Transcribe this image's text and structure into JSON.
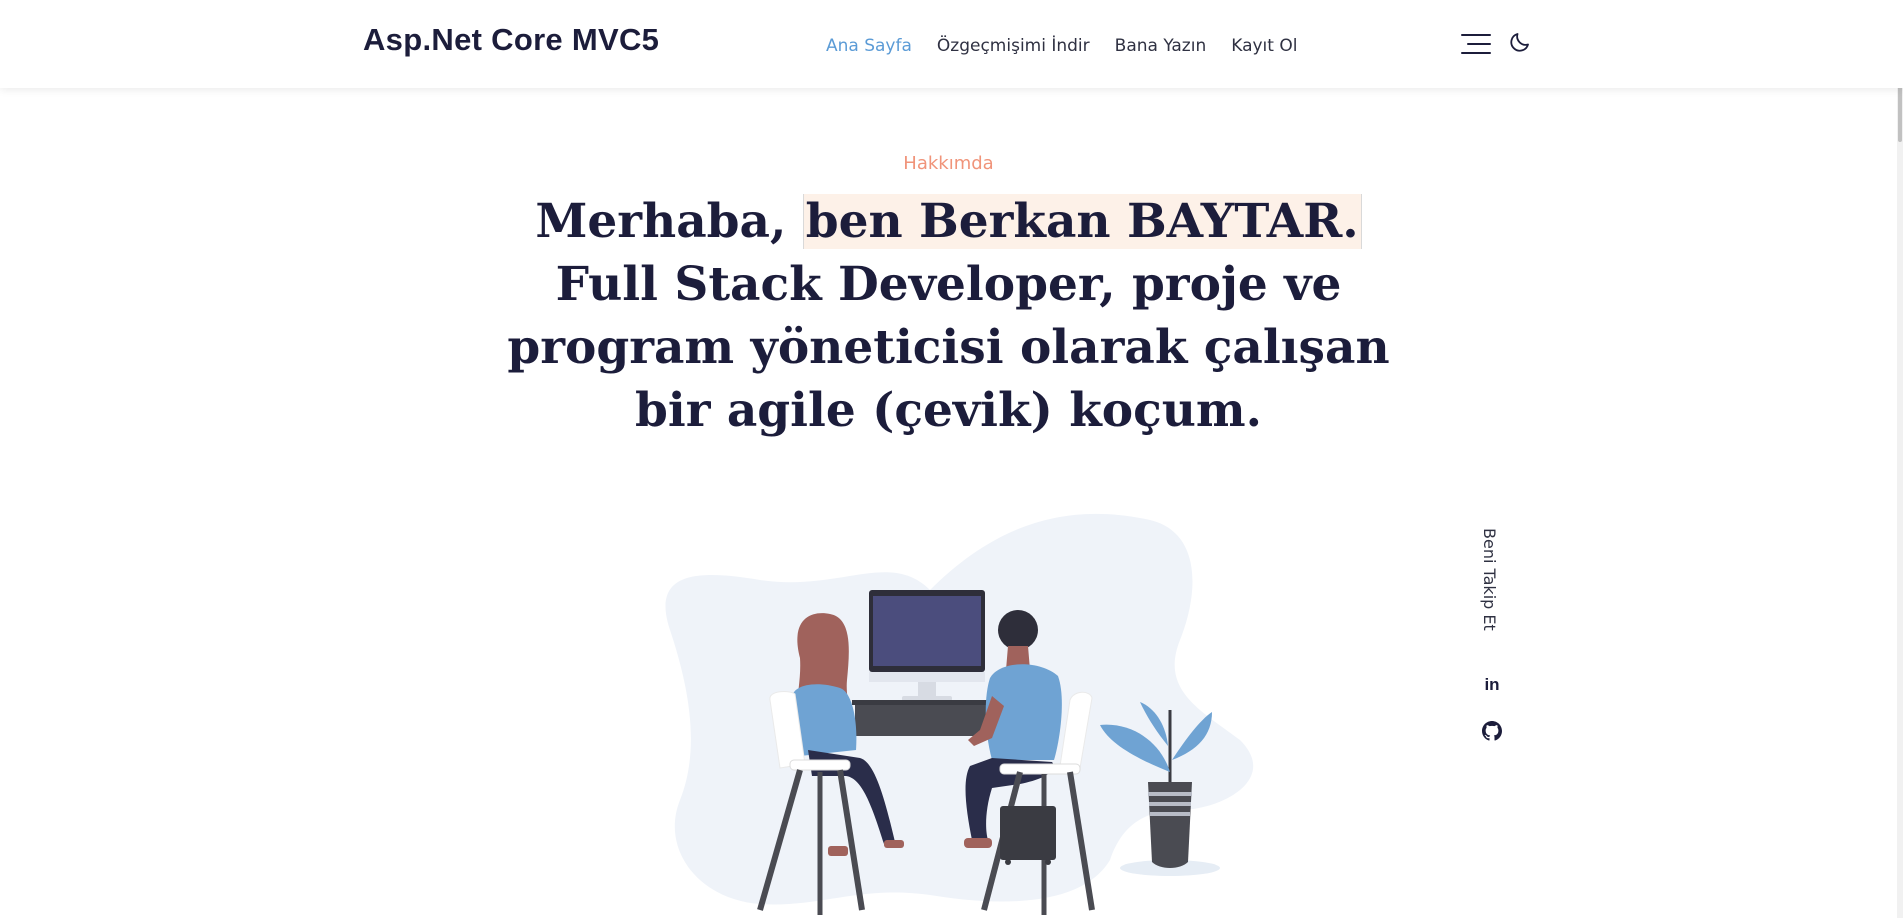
{
  "header": {
    "brand": "Asp.Net Core MVC5",
    "nav": [
      {
        "label": "Ana Sayfa",
        "active": true
      },
      {
        "label": "Özgeçmişimi İndir",
        "active": false
      },
      {
        "label": "Bana Yazın",
        "active": false
      },
      {
        "label": "Kayıt Ol",
        "active": false
      }
    ],
    "icons": [
      "menu-icon",
      "moon-icon"
    ]
  },
  "about": {
    "eyebrow": "Hakkımda",
    "headline_prefix": "Merhaba, ",
    "headline_highlight": "ben Berkan BAYTAR.",
    "headline_rest": "Full Stack Developer, proje ve program yöneticisi olarak çalışan bir agile (çevik) koçum."
  },
  "sidebar": {
    "follow_label": "Beni Takip Et",
    "socials": [
      "linkedin-icon",
      "github-icon"
    ]
  },
  "colors": {
    "accent_blue": "#5b9bd6",
    "accent_salmon": "#f0947a",
    "heading_navy": "#1c1d3b",
    "highlight_bg": "#fdf1e8"
  }
}
